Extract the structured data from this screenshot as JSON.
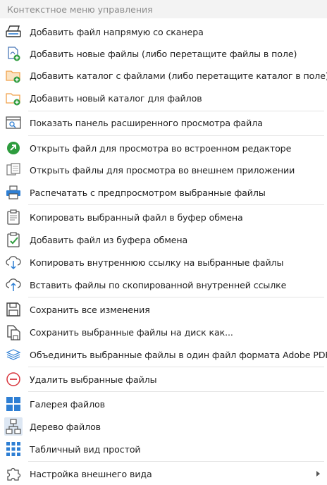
{
  "menu": {
    "title": "Контекстное меню управления",
    "items": [
      {
        "label": "Добавить файл напрямую со сканера",
        "icon": "scanner-icon"
      },
      {
        "label": "Добавить новые файлы (либо перетащите файлы в поле)",
        "icon": "add-files-icon"
      },
      {
        "label": "Добавить каталог с файлами (либо перетащите каталог в поле)",
        "icon": "add-folder-files-icon"
      },
      {
        "label": "Добавить новый каталог для файлов",
        "icon": "add-folder-icon"
      },
      {
        "label": "Показать панель расширенного просмотра файла",
        "icon": "preview-panel-icon"
      },
      {
        "label": "Открыть файл для просмотра во встроенном редакторе",
        "icon": "open-editor-icon"
      },
      {
        "label": "Открыть файлы для просмотра во внешнем приложении",
        "icon": "open-external-icon"
      },
      {
        "label": "Распечатать с предпросмотром выбранные файлы",
        "icon": "printer-icon"
      },
      {
        "label": "Копировать выбранный файл в буфер обмена",
        "icon": "clipboard-copy-icon"
      },
      {
        "label": "Добавить файл из буфера обмена",
        "icon": "clipboard-paste-icon"
      },
      {
        "label": "Копировать внутреннюю ссылку на выбранные файлы",
        "icon": "cloud-download-icon"
      },
      {
        "label": "Вставить файлы по скопированной внутренней ссылке",
        "icon": "cloud-upload-icon"
      },
      {
        "label": "Сохранить все изменения",
        "icon": "save-icon"
      },
      {
        "label": "Сохранить выбранные файлы на диск как...",
        "icon": "save-as-icon"
      },
      {
        "label": "Объединить выбранные файлы в один файл формата Adobe PDF",
        "icon": "merge-pdf-icon"
      },
      {
        "label": "Удалить выбранные файлы",
        "icon": "delete-icon"
      },
      {
        "label": "Галерея файлов",
        "icon": "gallery-icon"
      },
      {
        "label": "Дерево файлов",
        "icon": "tree-icon"
      },
      {
        "label": "Табличный вид простой",
        "icon": "table-view-icon"
      },
      {
        "label": "Настройка внешнего вида",
        "icon": "puzzle-icon"
      }
    ]
  },
  "colors": {
    "accent_blue": "#2e7fd4",
    "accent_orange": "#f0a14a",
    "accent_green": "#2e9c3e",
    "accent_red": "#d9363e",
    "text": "#1e1e1e",
    "header_text": "#8c8c8c"
  }
}
